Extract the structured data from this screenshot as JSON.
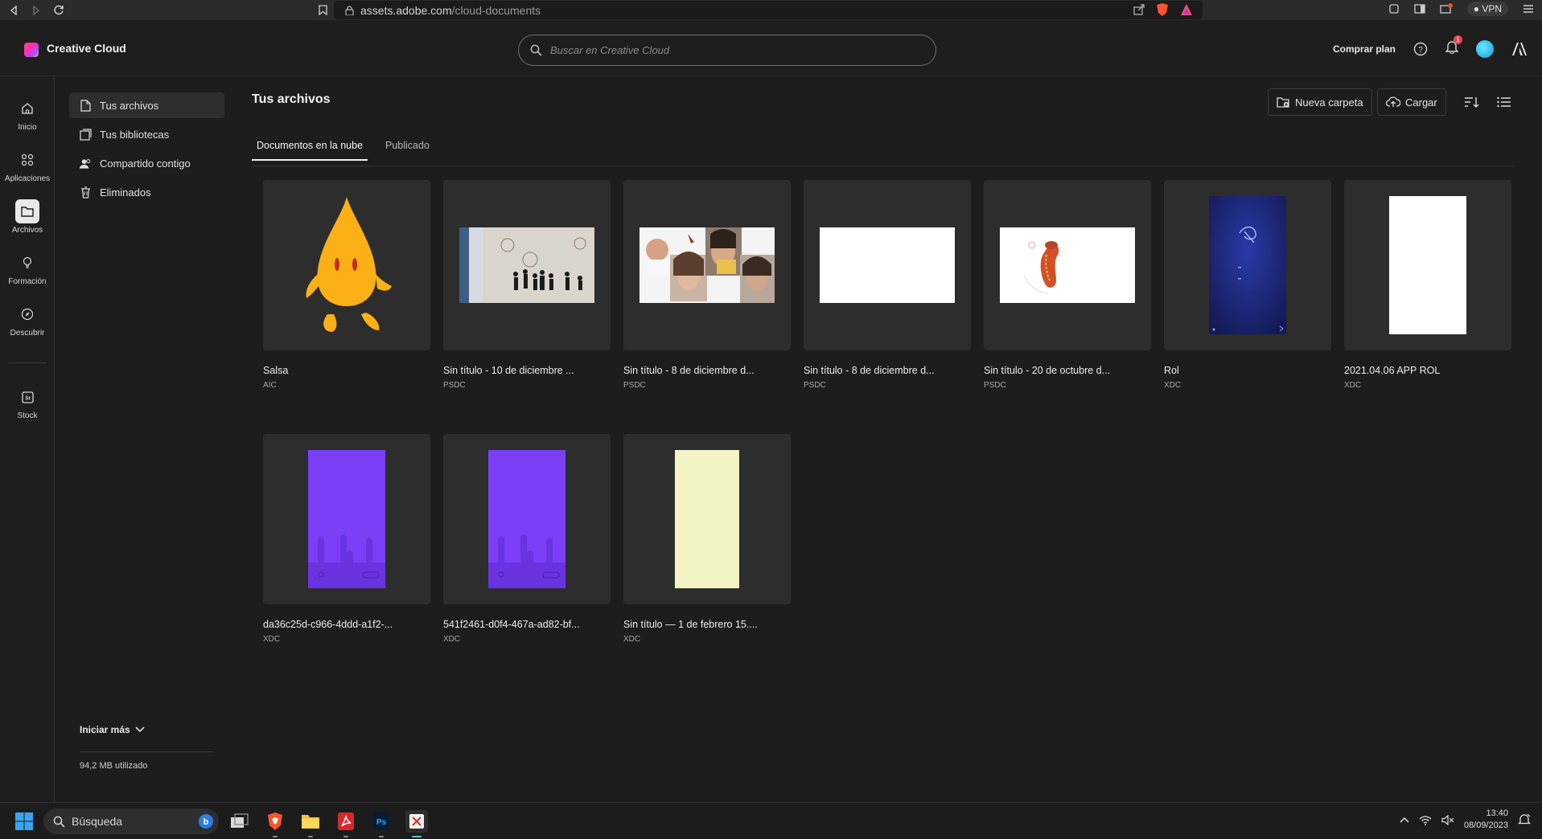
{
  "browser": {
    "url_domain": "assets.adobe.com",
    "url_path": "/cloud-documents",
    "vpn_label": "VPN"
  },
  "header": {
    "app_title": "Creative Cloud",
    "search_placeholder": "Buscar en Creative Cloud",
    "buy_plan": "Comprar plan",
    "notification_count": "1"
  },
  "rail": {
    "items": [
      {
        "label": "Inicio"
      },
      {
        "label": "Aplicaciones"
      },
      {
        "label": "Archivos"
      },
      {
        "label": "Formación"
      },
      {
        "label": "Descubrir"
      },
      {
        "label": "Stock"
      }
    ]
  },
  "sidebar": {
    "items": [
      {
        "label": "Tus archivos"
      },
      {
        "label": "Tus bibliotecas"
      },
      {
        "label": "Compartido contigo"
      },
      {
        "label": "Eliminados"
      }
    ],
    "more_label": "Iniciar más",
    "storage_used": "94,2 MB utilizado"
  },
  "main": {
    "title": "Tus archivos",
    "new_folder": "Nueva carpeta",
    "upload": "Cargar",
    "tabs": [
      {
        "label": "Documentos en la nube"
      },
      {
        "label": "Publicado"
      }
    ],
    "files": [
      {
        "name": "Salsa",
        "type": "AIC"
      },
      {
        "name": "Sin título - 10 de diciembre ...",
        "type": "PSDC"
      },
      {
        "name": "Sin título - 8 de diciembre d...",
        "type": "PSDC"
      },
      {
        "name": "Sin título - 8 de diciembre d...",
        "type": "PSDC"
      },
      {
        "name": "Sin título - 20 de octubre d...",
        "type": "PSDC"
      },
      {
        "name": "Rol",
        "type": "XDC"
      },
      {
        "name": "2021.04.06 APP ROL",
        "type": "XDC"
      },
      {
        "name": "da36c25d-c966-4ddd-a1f2-...",
        "type": "XDC"
      },
      {
        "name": "541f2461-d0f4-467a-ad82-bf...",
        "type": "XDC"
      },
      {
        "name": "Sin título — 1 de febrero 15....",
        "type": "XDC"
      }
    ]
  },
  "taskbar": {
    "search_label": "Búsqueda",
    "time": "13:40",
    "date": "08/09/2023"
  },
  "colors": {
    "accent_purple": "#7b3ff8",
    "salsa_orange": "#fbb016",
    "background": "#1d1d1d",
    "card": "#2d2d2d"
  }
}
